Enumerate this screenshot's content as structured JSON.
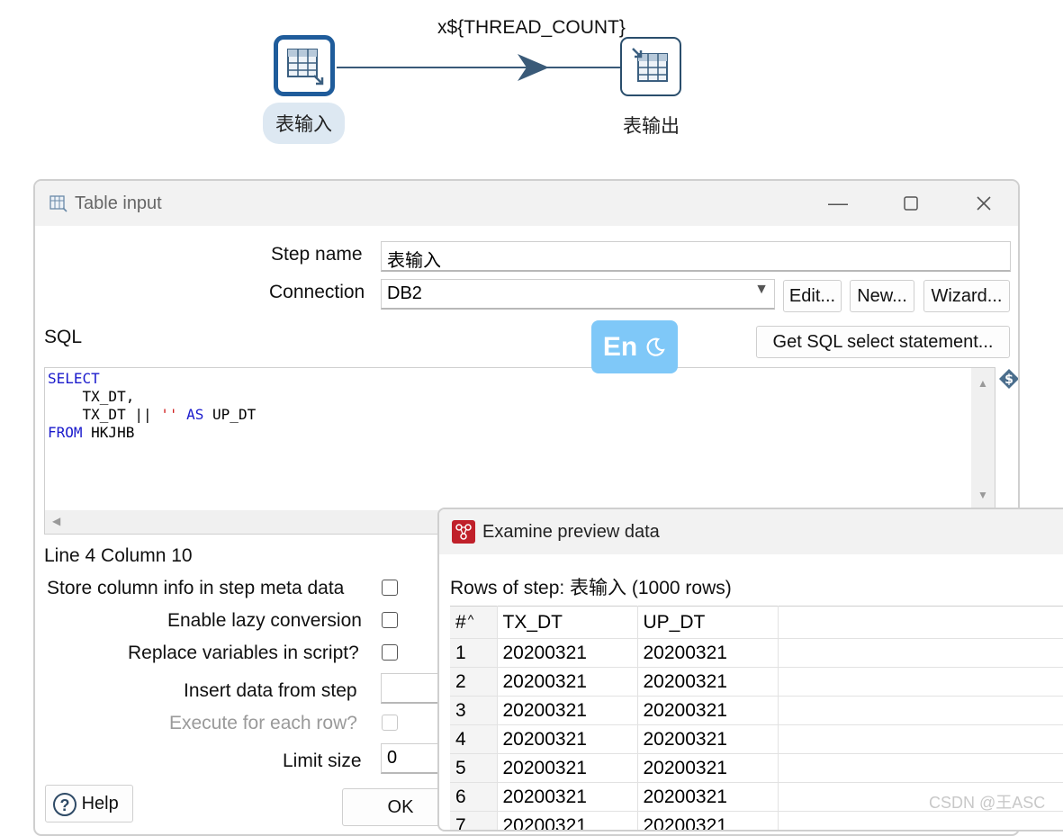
{
  "canvas": {
    "hop_label": "x${THREAD_COUNT}",
    "node_input_label": "表输入",
    "node_output_label": "表输出"
  },
  "dialog": {
    "title": "Table input",
    "step_name_label": "Step name",
    "step_name_value": "表输入",
    "connection_label": "Connection",
    "connection_value": "DB2",
    "edit_button": "Edit...",
    "new_button": "New...",
    "wizard_button": "Wizard...",
    "sql_label": "SQL",
    "get_sql_button": "Get SQL select statement...",
    "sql_lines": [
      {
        "kw1": "SELECT",
        "text": "",
        "str": "",
        "kw2": "",
        "tail": ""
      },
      {
        "kw1": "",
        "text": "    TX_DT,",
        "str": "",
        "kw2": "",
        "tail": ""
      },
      {
        "kw1": "",
        "text": "    TX_DT || ",
        "str": "''",
        "kw2": " AS",
        "tail": " UP_DT"
      },
      {
        "kw1": "FROM",
        "text": " HKJHB",
        "str": "",
        "kw2": "",
        "tail": ""
      }
    ],
    "cursor_position": "Line 4 Column 10",
    "store_column_info_label": "Store column info in step meta data",
    "lazy_conversion_label": "Enable lazy conversion",
    "replace_variables_label": "Replace variables in script?",
    "insert_data_label": "Insert data from step",
    "execute_each_row_label": "Execute for each row?",
    "limit_size_label": "Limit size",
    "limit_size_value": "0",
    "help_button": "Help",
    "ok_button": "OK"
  },
  "ime": {
    "label": "En",
    "moon_icon": "moon-icon"
  },
  "preview": {
    "title": "Examine preview data",
    "rows_label": "Rows of step: 表输入 (1000 rows)",
    "columns": [
      "#",
      "TX_DT",
      "UP_DT"
    ],
    "rows": [
      [
        "1",
        "20200321",
        "20200321"
      ],
      [
        "2",
        "20200321",
        "20200321"
      ],
      [
        "3",
        "20200321",
        "20200321"
      ],
      [
        "4",
        "20200321",
        "20200321"
      ],
      [
        "5",
        "20200321",
        "20200321"
      ],
      [
        "6",
        "20200321",
        "20200321"
      ],
      [
        "7",
        "20200321",
        "20200321"
      ]
    ]
  },
  "watermark": "CSDN @王ASC"
}
